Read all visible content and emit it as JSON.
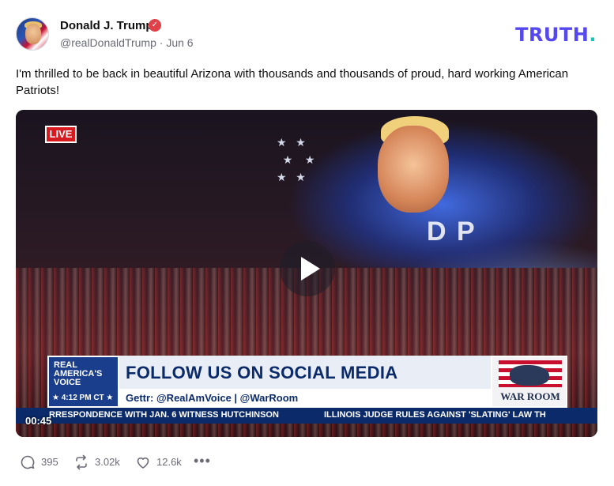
{
  "post": {
    "author": {
      "display_name": "Donald J. Trump",
      "handle": "@realDonaldTrump",
      "separator": "·",
      "date": "Jun 6",
      "verified": true
    },
    "brand": {
      "logo_text": "TRUTH",
      "logo_dot": ".",
      "logo_color": "#5448ee",
      "dot_color": "#17c5b9"
    },
    "text": "I'm thrilled to be back in beautiful Arizona with thousands and thousands of proud, hard working American Patriots!",
    "video": {
      "live_label": "LIVE",
      "screen_text": "D  P",
      "network_logo_lines": [
        "REAL",
        "AMERICA'S",
        "VOICE"
      ],
      "network_time": "★ 4:12 PM CT ★",
      "banner_title": "FOLLOW US ON SOCIAL MEDIA",
      "banner_sub": "Gettr: @RealAmVoice | @WarRoom",
      "show_logo": "WAR ROOM",
      "ticker_left": "RRESPONDENCE WITH JAN. 6 WITNESS HUTCHINSON",
      "ticker_right": "ILLINOIS JUDGE RULES AGAINST 'SLATING' LAW TH",
      "timestamp": "00:45"
    },
    "actions": {
      "replies": "395",
      "retruths": "3.02k",
      "likes": "12.6k",
      "more": "•••"
    }
  },
  "colors": {
    "accent": "#5448ee",
    "verified": "#e0424a",
    "muted_text": "#6b6b78",
    "live_red": "#d71920",
    "banner_navy": "#0b2a6a"
  }
}
